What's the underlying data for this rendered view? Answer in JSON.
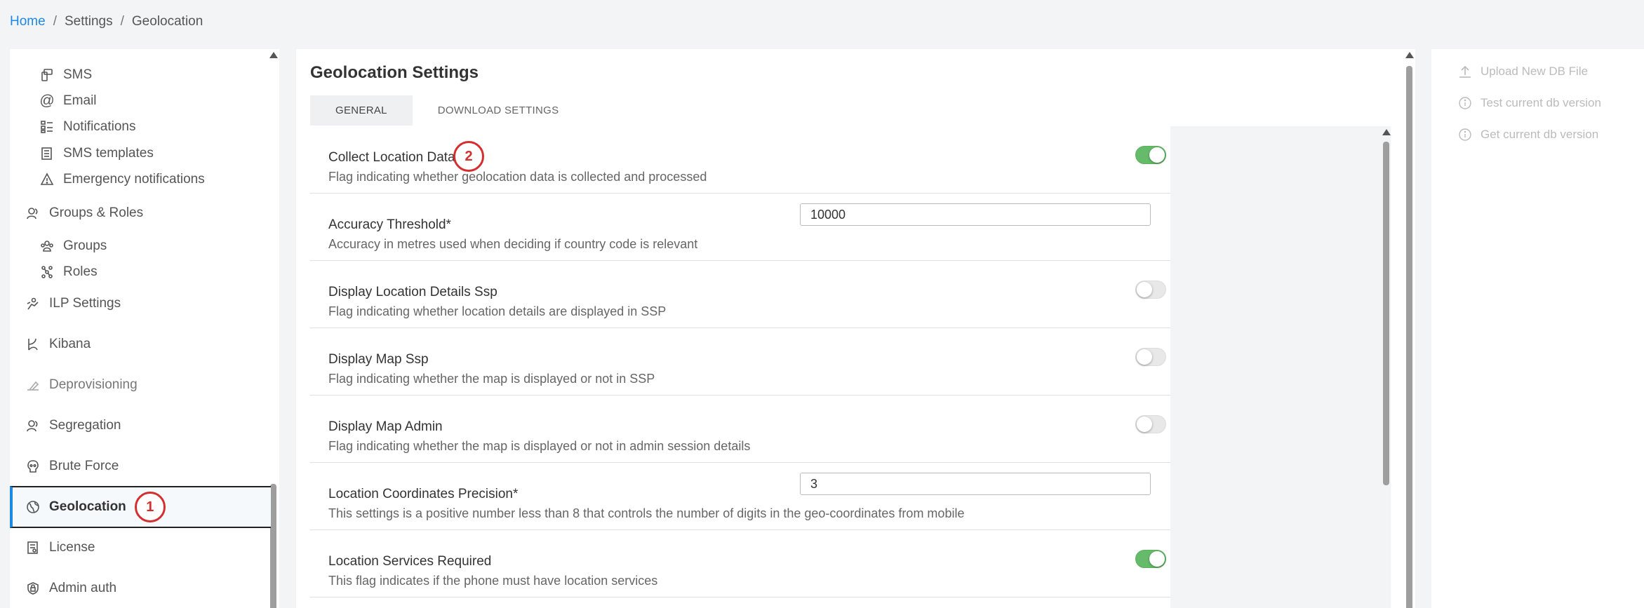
{
  "breadcrumb": {
    "home": "Home",
    "separator": "/",
    "settings": "Settings",
    "current": "Geolocation"
  },
  "sidebar": {
    "items": [
      {
        "label": "SMS",
        "icon": "sms-icon"
      },
      {
        "label": "Email",
        "icon": "at-icon"
      },
      {
        "label": "Notifications",
        "icon": "notifications-icon"
      },
      {
        "label": "SMS templates",
        "icon": "templates-icon"
      },
      {
        "label": "Emergency notifications",
        "icon": "warning-icon"
      },
      {
        "label": "Groups & Roles",
        "icon": "groups-roles-icon"
      },
      {
        "label": "Groups",
        "icon": "groups-icon"
      },
      {
        "label": "Roles",
        "icon": "roles-icon"
      },
      {
        "label": "ILP Settings",
        "icon": "ilp-icon"
      },
      {
        "label": "Kibana",
        "icon": "kibana-icon"
      },
      {
        "label": "Deprovisioning",
        "icon": "deprovisioning-icon"
      },
      {
        "label": "Segregation",
        "icon": "segregation-icon"
      },
      {
        "label": "Brute Force",
        "icon": "skull-icon"
      },
      {
        "label": "Geolocation",
        "icon": "globe-icon",
        "badge": "1"
      },
      {
        "label": "License",
        "icon": "license-icon"
      },
      {
        "label": "Admin auth",
        "icon": "admin-auth-icon"
      }
    ]
  },
  "main": {
    "title": "Geolocation Settings",
    "tabs": [
      {
        "label": "GENERAL"
      },
      {
        "label": "DOWNLOAD SETTINGS"
      }
    ],
    "settings": [
      {
        "label": "Collect Location Data",
        "desc": "Flag indicating whether geolocation data is collected and processed",
        "type": "toggle",
        "on": true,
        "badge": "2"
      },
      {
        "label": "Accuracy Threshold*",
        "desc": "Accuracy in metres used when deciding if country code is relevant",
        "type": "input",
        "value": "10000"
      },
      {
        "label": "Display Location Details Ssp",
        "desc": "Flag indicating whether location details are displayed in SSP",
        "type": "toggle",
        "on": false
      },
      {
        "label": "Display Map Ssp",
        "desc": "Flag indicating whether the map is displayed or not in SSP",
        "type": "toggle",
        "on": false
      },
      {
        "label": "Display Map Admin",
        "desc": "Flag indicating whether the map is displayed or not in admin session details",
        "type": "toggle",
        "on": false
      },
      {
        "label": "Location Coordinates Precision*",
        "desc": "This settings is a positive number less than 8 that controls the number of digits in the geo-coordinates from mobile",
        "type": "input",
        "value": "3"
      },
      {
        "label": "Location Services Required",
        "desc": "This flag indicates if the phone must have location services",
        "type": "toggle",
        "on": true
      }
    ]
  },
  "actions": [
    {
      "label": "Upload New DB File",
      "icon": "upload-icon"
    },
    {
      "label": "Test current db version",
      "icon": "info-icon"
    },
    {
      "label": "Get current db version",
      "icon": "info-icon"
    }
  ],
  "colors": {
    "accent": "#1e88e5",
    "toggle_on": "#66bb6a",
    "badge": "#d32f2f"
  }
}
